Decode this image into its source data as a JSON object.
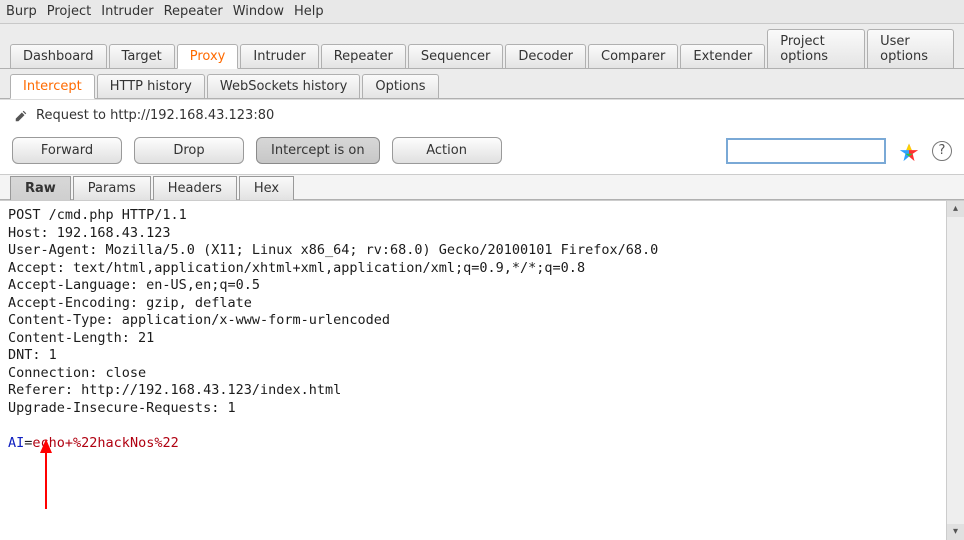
{
  "menubar": [
    "Burp",
    "Project",
    "Intruder",
    "Repeater",
    "Window",
    "Help"
  ],
  "mainTabs": [
    {
      "label": "Dashboard",
      "active": false
    },
    {
      "label": "Target",
      "active": false
    },
    {
      "label": "Proxy",
      "active": true,
      "orange": true
    },
    {
      "label": "Intruder",
      "active": false
    },
    {
      "label": "Repeater",
      "active": false
    },
    {
      "label": "Sequencer",
      "active": false
    },
    {
      "label": "Decoder",
      "active": false
    },
    {
      "label": "Comparer",
      "active": false
    },
    {
      "label": "Extender",
      "active": false
    },
    {
      "label": "Project options",
      "active": false
    },
    {
      "label": "User options",
      "active": false
    }
  ],
  "subTabs": [
    {
      "label": "Intercept",
      "active": true,
      "orange": true
    },
    {
      "label": "HTTP history",
      "active": false
    },
    {
      "label": "WebSockets history",
      "active": false
    },
    {
      "label": "Options",
      "active": false
    }
  ],
  "requestLine": "Request to http://192.168.43.123:80",
  "buttons": {
    "forward": "Forward",
    "drop": "Drop",
    "intercept": "Intercept is on",
    "action": "Action"
  },
  "search": {
    "value": ""
  },
  "viewTabs": [
    {
      "label": "Raw",
      "active": true
    },
    {
      "label": "Params",
      "active": false
    },
    {
      "label": "Headers",
      "active": false
    },
    {
      "label": "Hex",
      "active": false
    }
  ],
  "rawLines": [
    "POST /cmd.php HTTP/1.1",
    "Host: 192.168.43.123",
    "User-Agent: Mozilla/5.0 (X11; Linux x86_64; rv:68.0) Gecko/20100101 Firefox/68.0",
    "Accept: text/html,application/xhtml+xml,application/xml;q=0.9,*/*;q=0.8",
    "Accept-Language: en-US,en;q=0.5",
    "Accept-Encoding: gzip, deflate",
    "Content-Type: application/x-www-form-urlencoded",
    "Content-Length: 21",
    "DNT: 1",
    "Connection: close",
    "Referer: http://192.168.43.123/index.html",
    "Upgrade-Insecure-Requests: 1",
    ""
  ],
  "bodyParam": {
    "name": "AI",
    "value": "echo+%22hackNos%22"
  }
}
